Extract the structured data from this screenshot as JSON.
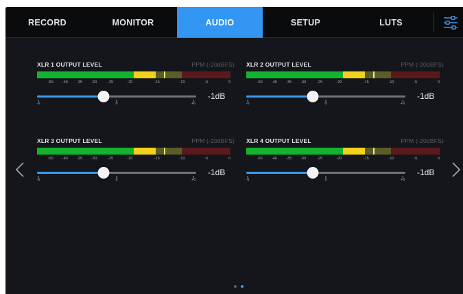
{
  "tabs": [
    {
      "label": "RECORD",
      "active": false
    },
    {
      "label": "MONITOR",
      "active": false
    },
    {
      "label": "AUDIO",
      "active": true
    },
    {
      "label": "SETUP",
      "active": false
    },
    {
      "label": "LUTS",
      "active": false
    }
  ],
  "settings_icon": "sliders-icon",
  "meter_scale": [
    "-50",
    "-40",
    "-35",
    "-30",
    "-25",
    "-20",
    "-15",
    "-10",
    "-5",
    "0"
  ],
  "slider_scale": {
    "min": "-6",
    "mid": "0",
    "max": "+6"
  },
  "channels": [
    {
      "title": "XLR 1 OUTPUT LEVEL",
      "scale": "PPM (-20dBFS)",
      "level_db": -1,
      "level_text": "-1dB"
    },
    {
      "title": "XLR 2 OUTPUT LEVEL",
      "scale": "PPM (-20dBFS)",
      "level_db": -1,
      "level_text": "-1dB"
    },
    {
      "title": "XLR 3 OUTPUT LEVEL",
      "scale": "PPM (-20dBFS)",
      "level_db": -1,
      "level_text": "-1dB"
    },
    {
      "title": "XLR 4 OUTPUT LEVEL",
      "scale": "PPM (-20dBFS)",
      "level_db": -1,
      "level_text": "-1dB"
    }
  ],
  "meter_colors": {
    "green": "#12b42e",
    "yellow": "#f3d21c",
    "olive": "#5c5c26",
    "red": "#5a1a1c",
    "slider_fill": "#3a9bf0",
    "accent": "#3396f2"
  },
  "navigation": {
    "prev_icon": "chevron-left-icon",
    "next_icon": "chevron-right-icon"
  },
  "pagination": {
    "pages": 2,
    "current": 2
  }
}
